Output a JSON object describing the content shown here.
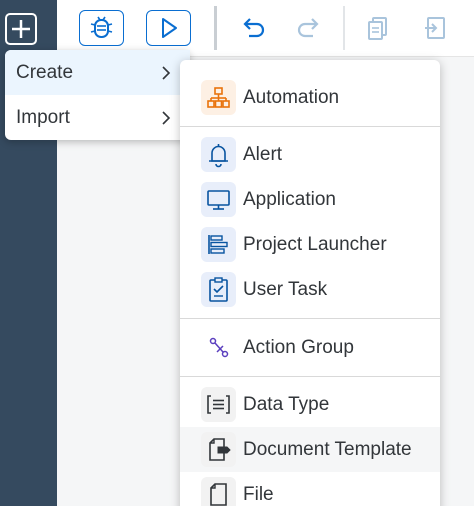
{
  "colors": {
    "rail": "#354a5f",
    "accent": "#0a6ed1",
    "disabled_icon": "#a9c4dc",
    "automation_icon": "#e9730c",
    "item_icon": "#0854a0",
    "item_icon_bg": "#e8eefa",
    "text": "#32363a"
  },
  "rail": {
    "add_icon": "plus-icon"
  },
  "toolbar": {
    "buttons": [
      {
        "icon": "debug-icon"
      },
      {
        "icon": "play-icon"
      },
      {
        "icon": "undo-icon"
      },
      {
        "icon": "redo-icon"
      },
      {
        "icon": "copy-icon"
      },
      {
        "icon": "paste-icon"
      }
    ]
  },
  "context_menu": {
    "items": [
      {
        "label": "Create",
        "icon": "chevron-right-icon",
        "active": true
      },
      {
        "label": "Import",
        "icon": "chevron-right-icon",
        "active": false
      }
    ]
  },
  "create_submenu": {
    "groups": [
      {
        "items": [
          {
            "label": "Automation",
            "icon": "automation-icon"
          }
        ]
      },
      {
        "items": [
          {
            "label": "Alert",
            "icon": "bell-icon"
          },
          {
            "label": "Application",
            "icon": "monitor-icon"
          },
          {
            "label": "Project Launcher",
            "icon": "launcher-icon"
          },
          {
            "label": "User Task",
            "icon": "clipboard-task-icon"
          }
        ]
      },
      {
        "items": [
          {
            "label": "Action Group",
            "icon": "action-group-icon"
          }
        ]
      },
      {
        "items": [
          {
            "label": "Data Type",
            "icon": "data-type-icon"
          },
          {
            "label": "Document Template",
            "icon": "document-template-icon"
          },
          {
            "label": "File",
            "icon": "file-icon"
          }
        ]
      }
    ]
  }
}
